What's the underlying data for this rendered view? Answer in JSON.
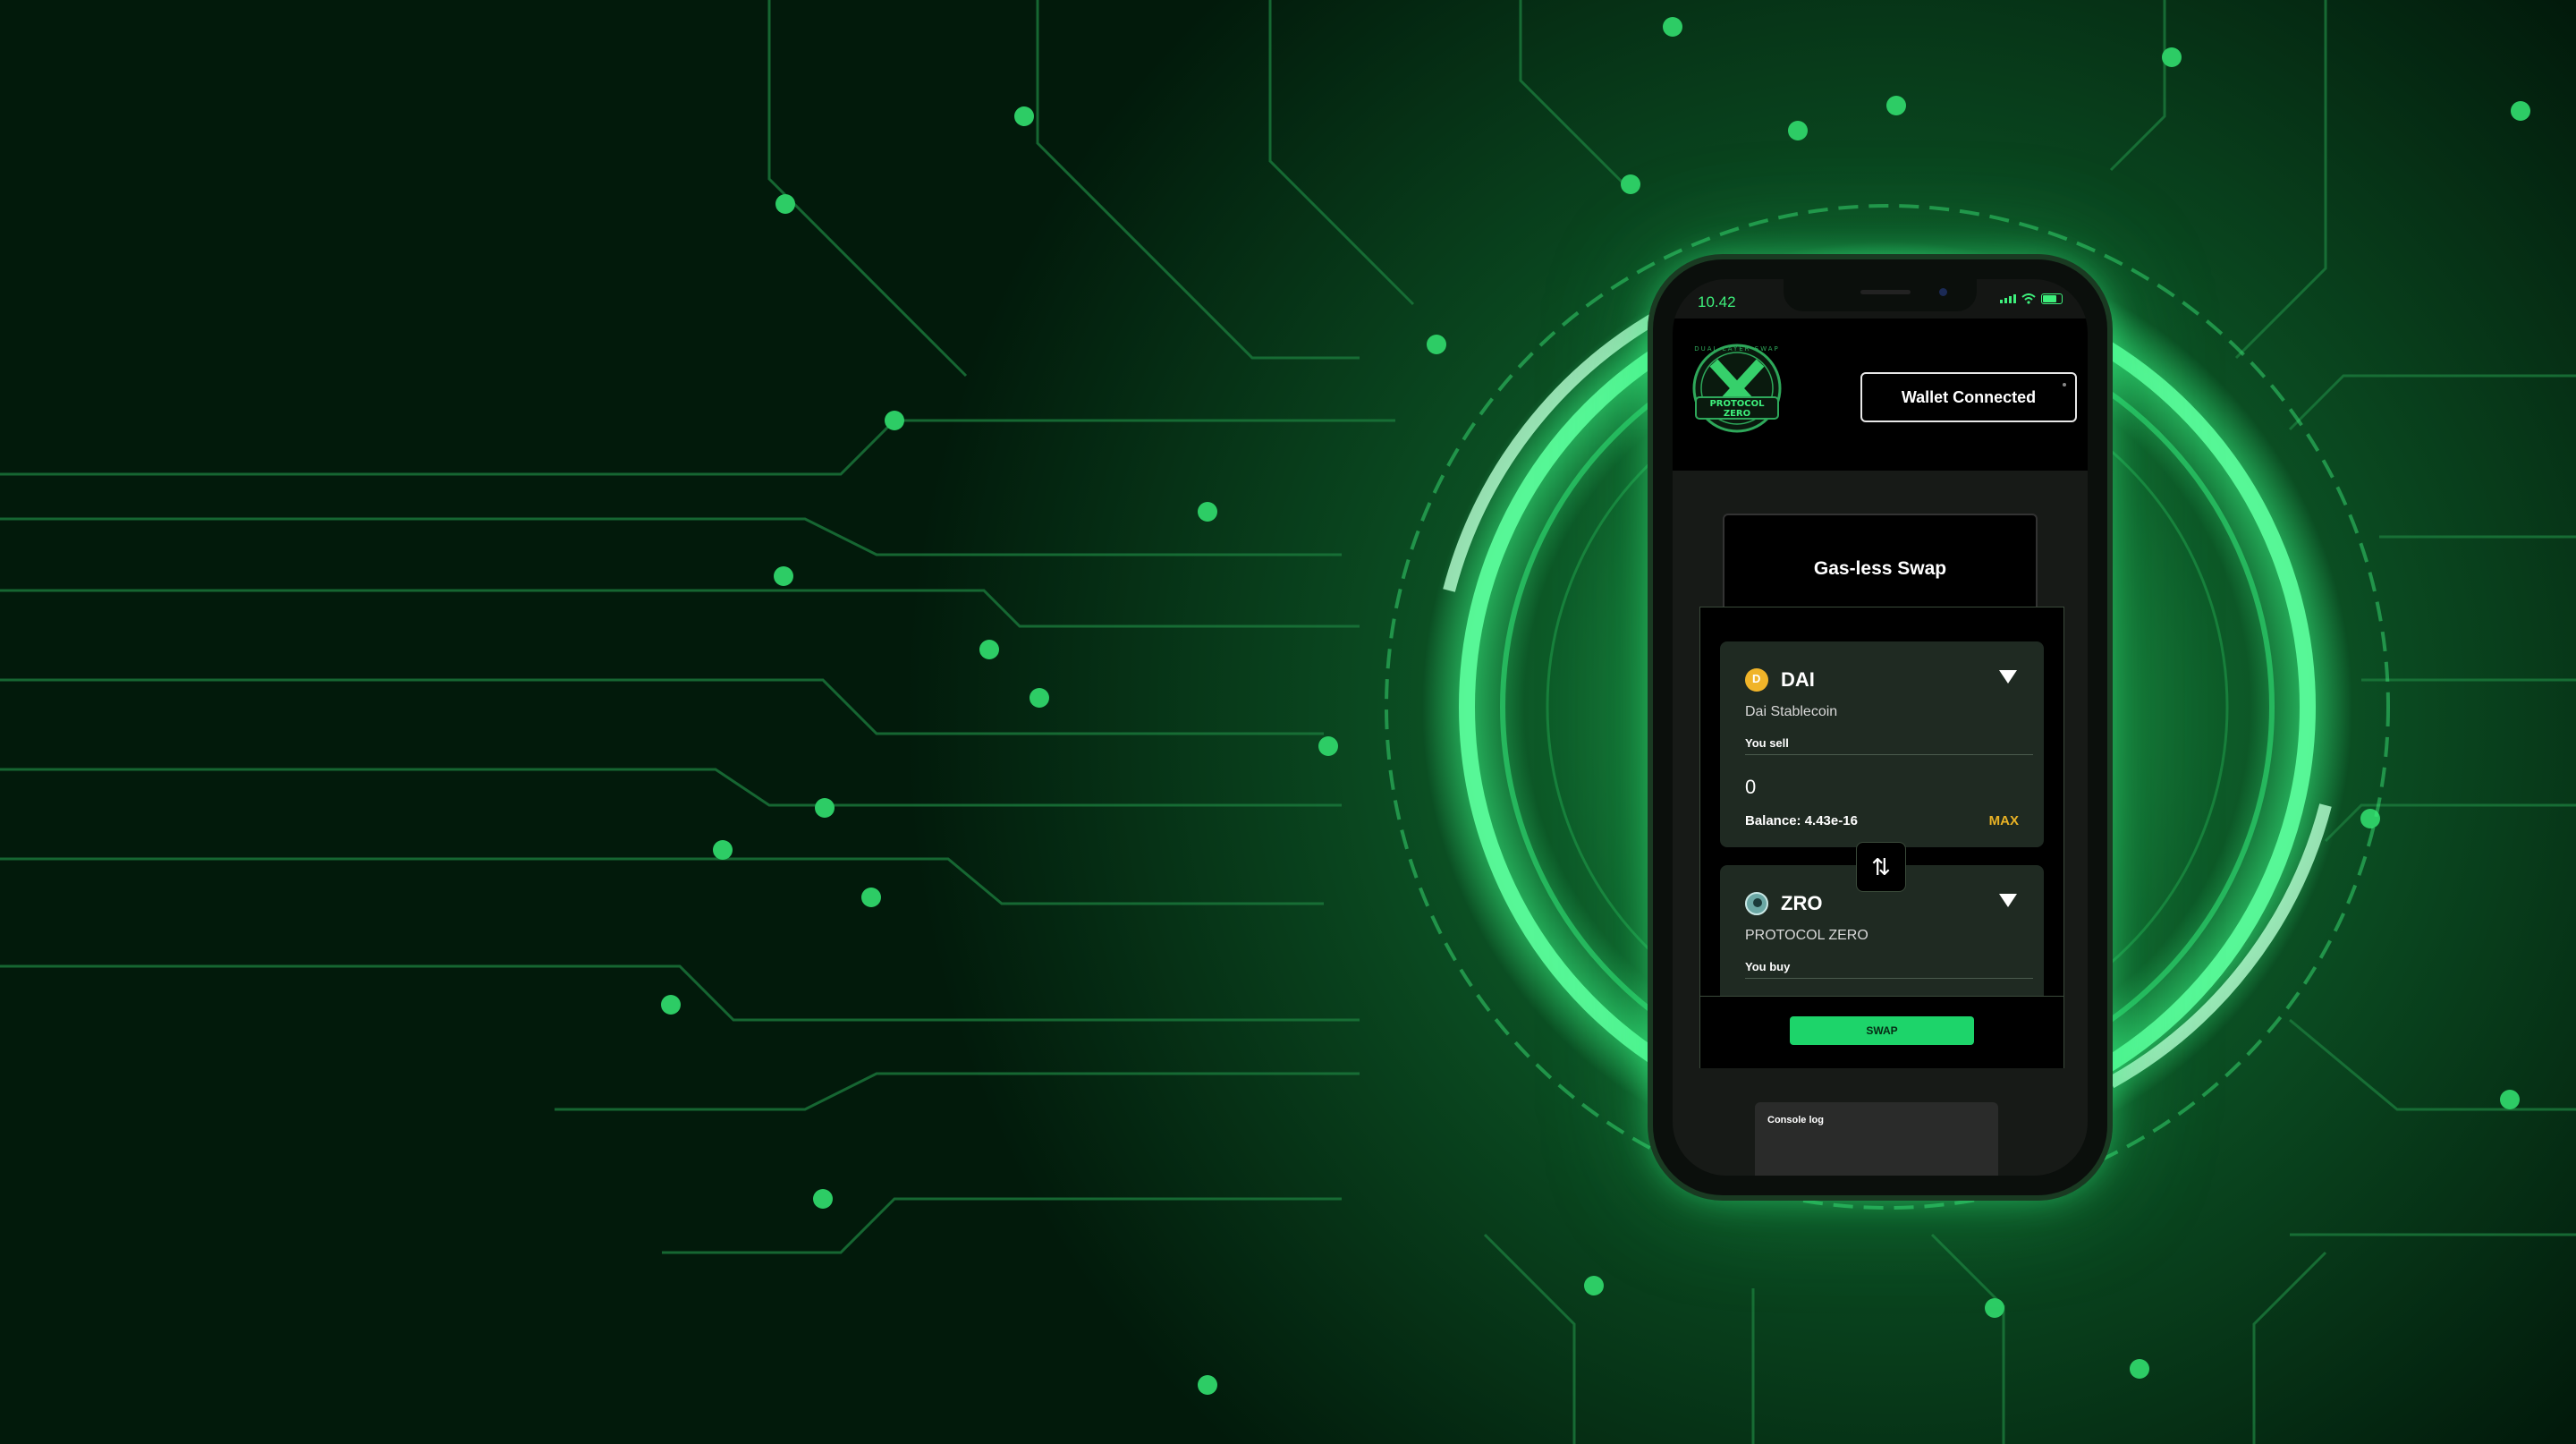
{
  "phone": {
    "status_time": "10.42"
  },
  "header": {
    "logo_ring_text": "DUAL LAYER SWAP",
    "logo_line1": "PROTOCOL",
    "logo_line2": "ZERO",
    "wallet_button": "Wallet Connected"
  },
  "swap": {
    "title": "Gas-less Swap",
    "sell": {
      "symbol": "DAI",
      "name": "Dai Stablecoin",
      "caption": "You sell",
      "amount": "0",
      "balance": "Balance: 4.43e-16",
      "max": "MAX",
      "icon": "dai-coin-icon"
    },
    "buy": {
      "symbol": "ZRO",
      "name": "PROTOCOL ZERO",
      "caption": "You buy",
      "icon": "zro-coin-icon"
    },
    "switch_icon": "swap-arrows-icon",
    "swap_button": "SWAP"
  },
  "console": {
    "label": "Console log"
  },
  "colors": {
    "accent": "#1dd46a",
    "neon": "#3ef07c",
    "max": "#e8b225",
    "background": "#021a0b"
  }
}
